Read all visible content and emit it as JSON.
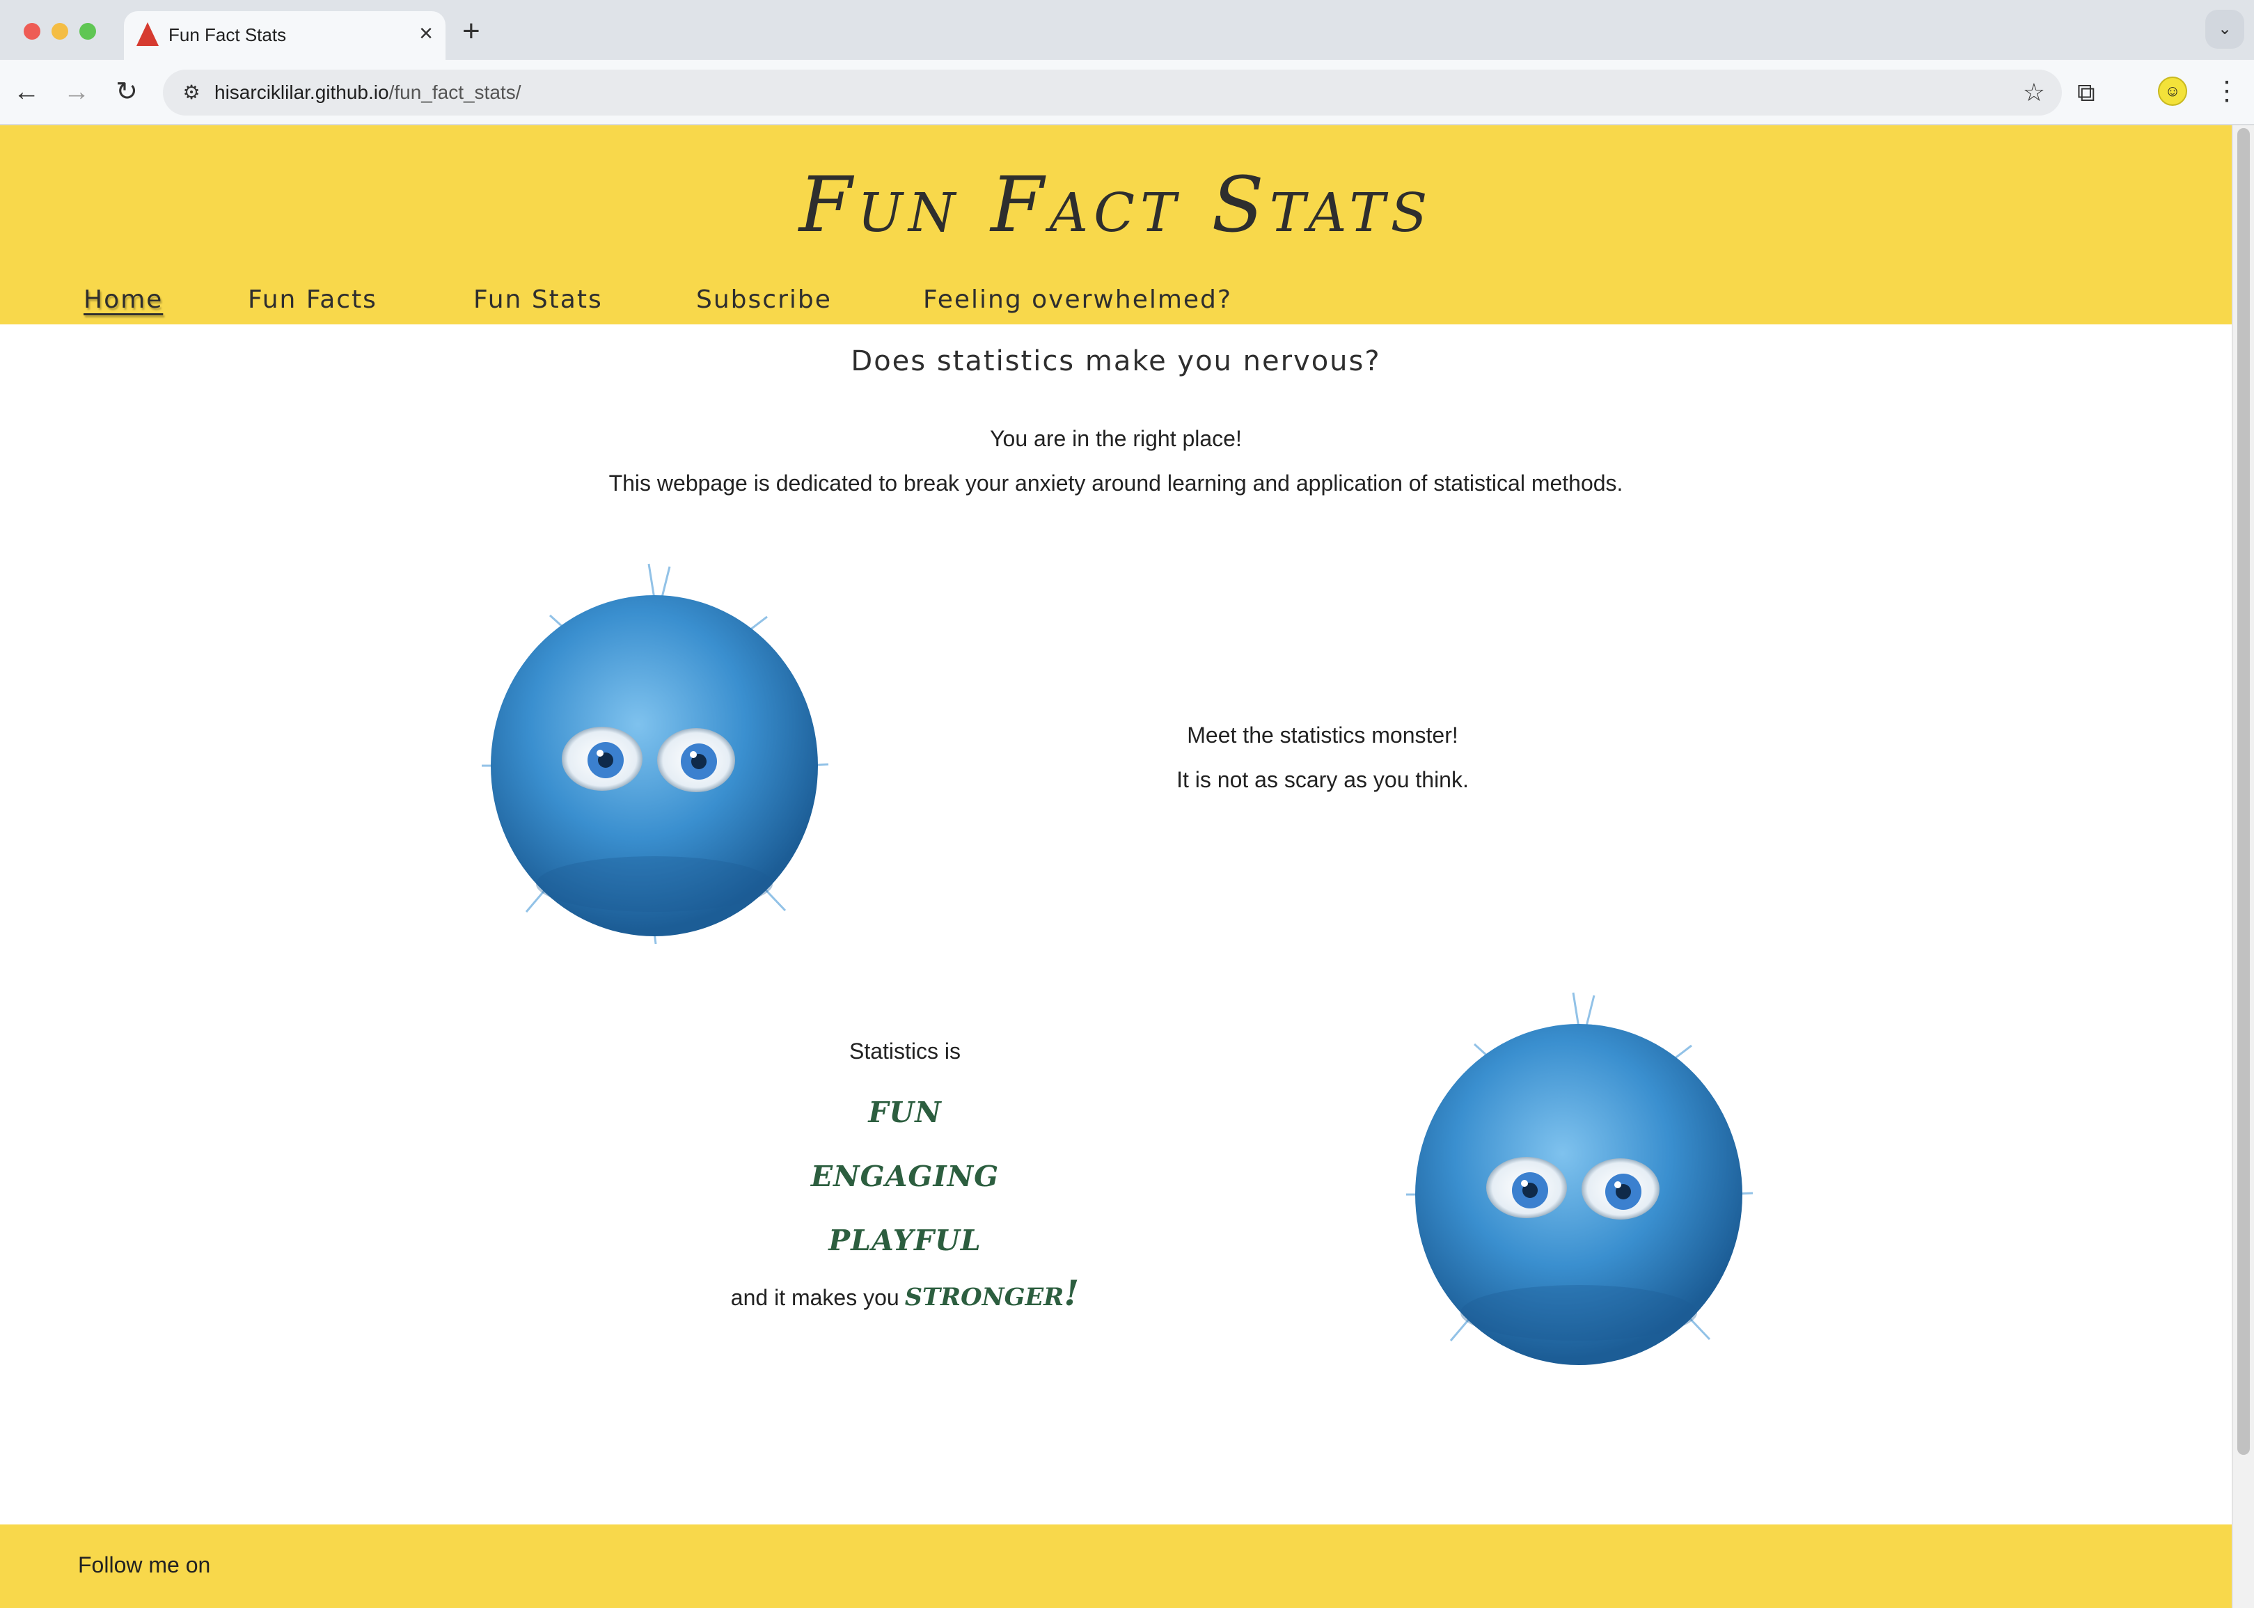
{
  "browser": {
    "tab_title": "Fun Fact Stats",
    "new_tab_symbol": "+",
    "url_host": "hisarciklilar.github.io",
    "url_path": "/fun_fact_stats/"
  },
  "site": {
    "title": "Fun Fact Stats",
    "nav": [
      "Home",
      "Fun Facts",
      "Fun Stats",
      "Subscribe",
      "Feeling overwhelmed?"
    ],
    "active_nav": "Home",
    "accent_color": "#f8d84b",
    "word_color": "#2c5e3f"
  },
  "main": {
    "subtitle": "Does statistics make you nervous?",
    "intro_line1": "You are in the right place!",
    "intro_line2": "This webpage is dedicated to break your anxiety around learning and application of statistical methods.",
    "meet_line1": "Meet the statistics monster!",
    "meet_line2": "It is not as scary as you think.",
    "stats_is": "Statistics is",
    "words": [
      "fun",
      "engaging",
      "playful"
    ],
    "makes_you": "and it makes you",
    "stronger": "stronger!"
  },
  "footer": {
    "follow": "Follow me on"
  },
  "icons": [
    "favicon-bell-curve-icon",
    "close-icon",
    "back-icon",
    "forward-icon",
    "reload-icon",
    "site-settings-icon",
    "star-icon",
    "extensions-icon",
    "profile-icon",
    "menu-icon",
    "chevron-down-icon"
  ]
}
